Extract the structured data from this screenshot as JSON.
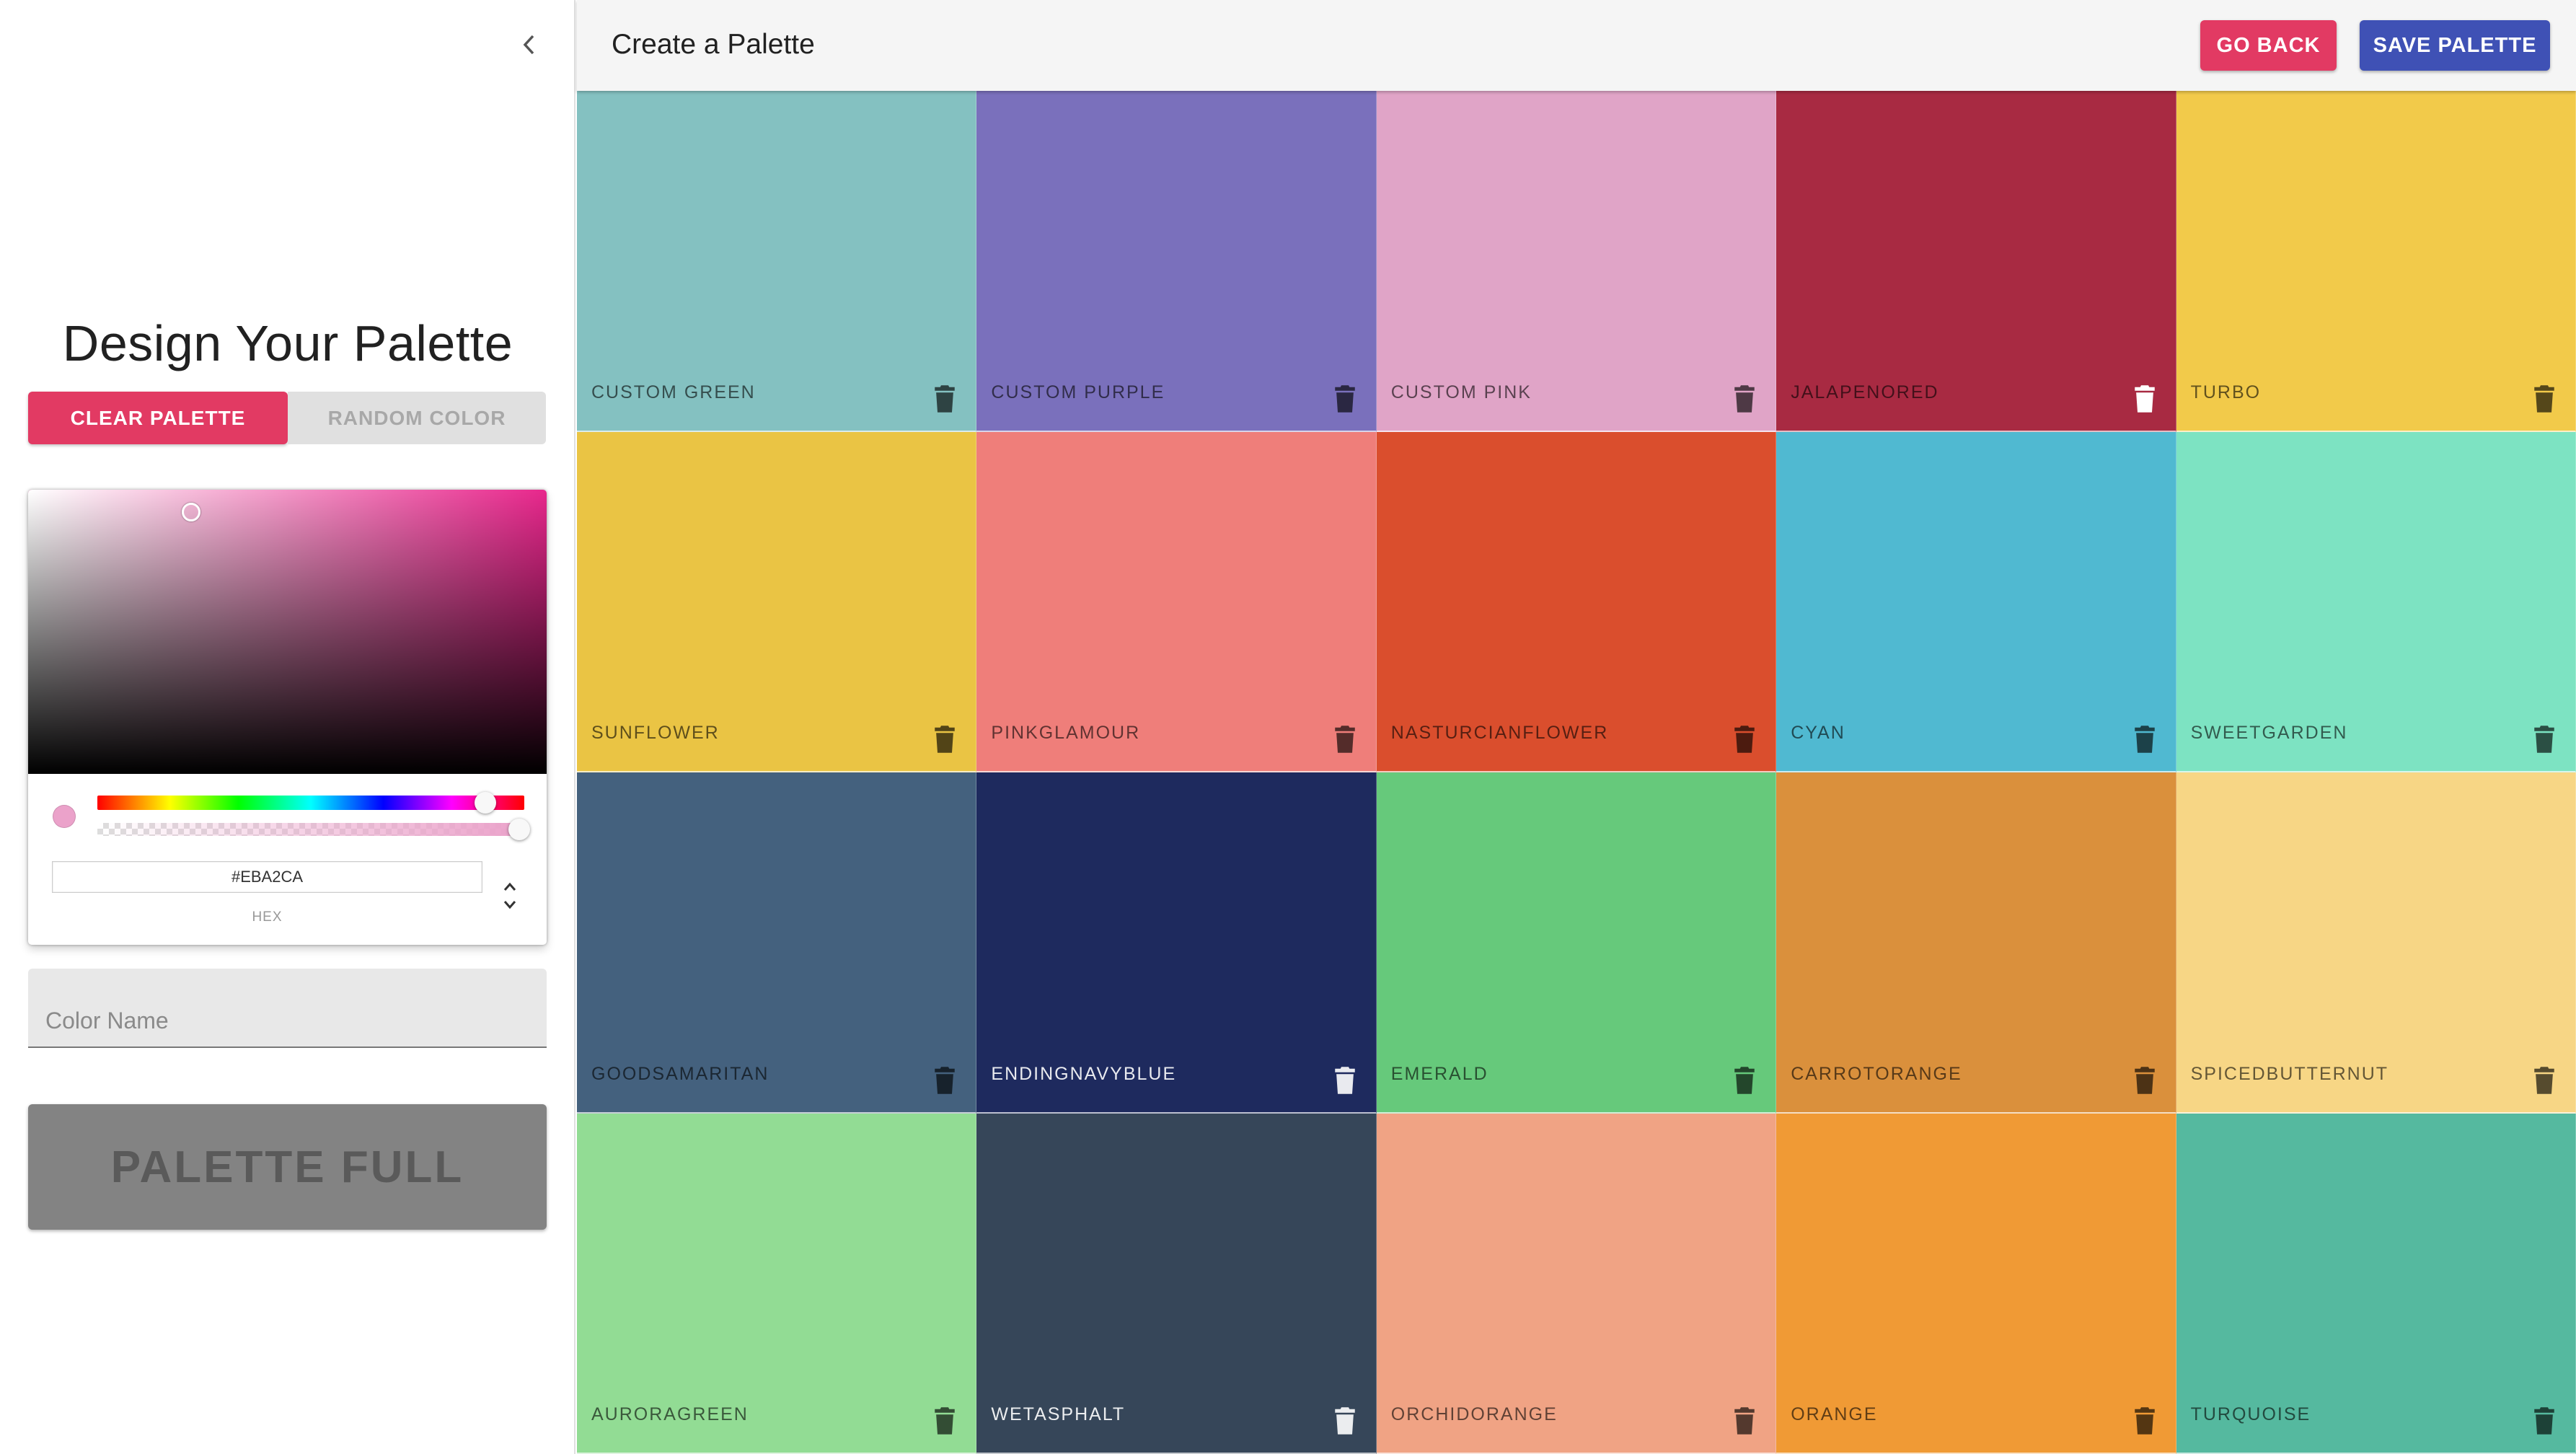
{
  "sidebar": {
    "title": "Design Your Palette",
    "clear_label": "CLEAR PALETTE",
    "random_label": "RANDOM COLOR",
    "picker": {
      "current_color": "#EBA2CA",
      "hex_value": "#EBA2CA",
      "hex_label": "HEX"
    },
    "color_name_placeholder": "Color Name",
    "palette_full_label": "PALETTE FULL"
  },
  "appbar": {
    "title": "Create a Palette",
    "back_label": "GO BACK",
    "save_label": "SAVE PALETTE",
    "accent_back": "#e23a63",
    "accent_save": "#3f51b5"
  },
  "colors": [
    {
      "name": "custom green",
      "color": "#84c1c1",
      "text": "dark"
    },
    {
      "name": "custom purple",
      "color": "#7a70bc",
      "text": "dark"
    },
    {
      "name": "custom pink",
      "color": "#e0a4c7",
      "text": "dark"
    },
    {
      "name": "jalapenored",
      "color": "#a82a42",
      "text": "light-name-dark"
    },
    {
      "name": "turbo",
      "color": "#f2ca4a",
      "text": "dark"
    },
    {
      "name": "sunflower",
      "color": "#eac444",
      "text": "dark"
    },
    {
      "name": "pinkglamour",
      "color": "#ef7e7a",
      "text": "dark"
    },
    {
      "name": "nasturcianflower",
      "color": "#da4e2d",
      "text": "dark"
    },
    {
      "name": "cyan",
      "color": "#50b9d1",
      "text": "dark"
    },
    {
      "name": "sweetgarden",
      "color": "#7de3c2",
      "text": "dark"
    },
    {
      "name": "goodsamaritan",
      "color": "#44617e",
      "text": "dark"
    },
    {
      "name": "endingnavyblue",
      "color": "#1e2a5e",
      "text": "light"
    },
    {
      "name": "emerald",
      "color": "#66c97b",
      "text": "dark"
    },
    {
      "name": "carrotorange",
      "color": "#da903c",
      "text": "dark"
    },
    {
      "name": "spicedbutternut",
      "color": "#f7d685",
      "text": "dark"
    },
    {
      "name": "auroragreen",
      "color": "#92dc94",
      "text": "dark"
    },
    {
      "name": "wetasphalt",
      "color": "#364659",
      "text": "light"
    },
    {
      "name": "orchidorange",
      "color": "#f0a384",
      "text": "dark"
    },
    {
      "name": "orange",
      "color": "#f09a35",
      "text": "dark"
    },
    {
      "name": "turquoise",
      "color": "#55b99f",
      "text": "dark"
    }
  ]
}
